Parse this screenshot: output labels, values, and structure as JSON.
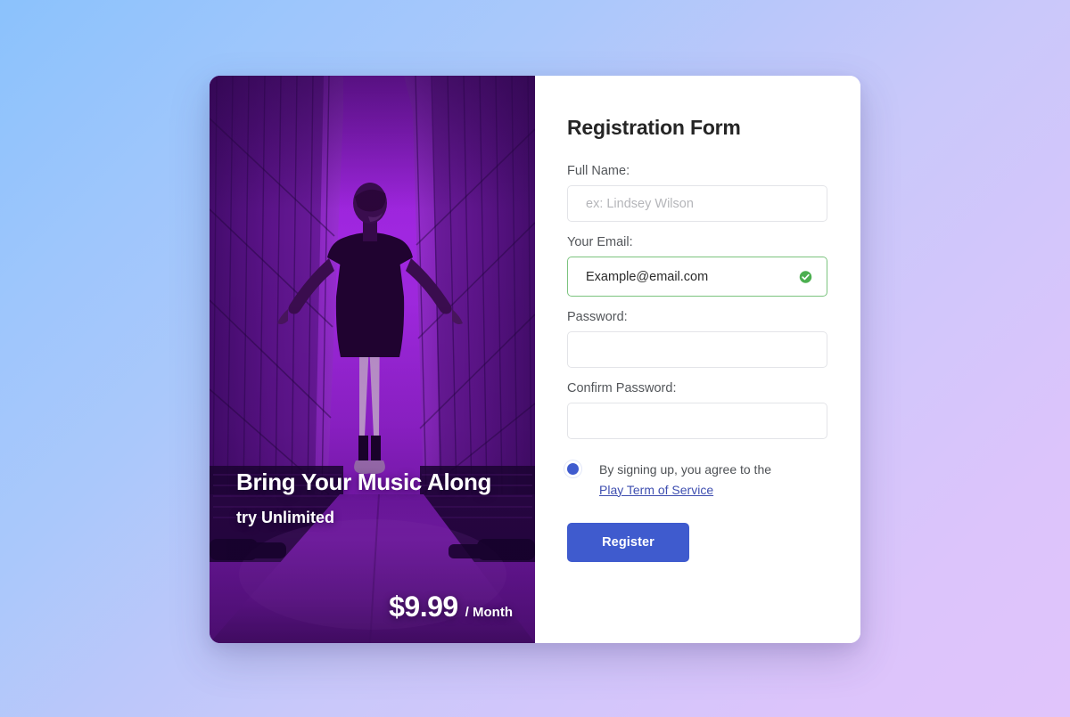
{
  "background": {
    "gradient_from": "#8bc2fc",
    "gradient_to": "#e0c4fb"
  },
  "promo": {
    "headline": "Bring Your Music Along",
    "subheadline": "try Unlimited",
    "price": "$9.99",
    "period": "/ Month",
    "photo_alt": "person-with-outstretched-arms-in-alley",
    "photo_tint": "#8a1fd0"
  },
  "form": {
    "title": "Registration Form",
    "fields": [
      {
        "label": "Full Name:",
        "placeholder": "ex: Lindsey Wilson",
        "value": "",
        "state": "empty"
      },
      {
        "label": "Your Email:",
        "placeholder": "",
        "value": "Example@email.com",
        "state": "valid"
      },
      {
        "label": "Password:",
        "placeholder": "",
        "value": "",
        "state": "empty"
      },
      {
        "label": "Confirm Password:",
        "placeholder": "",
        "value": "",
        "state": "empty"
      }
    ],
    "terms": {
      "text": "By signing up, you agree to the",
      "link_label": "Play Term of Service",
      "radio_selected": true,
      "radio_color": "#3f5bce"
    },
    "submit_label": "Register",
    "submit_color": "#3f5bce",
    "valid_color": "#4caf50"
  }
}
